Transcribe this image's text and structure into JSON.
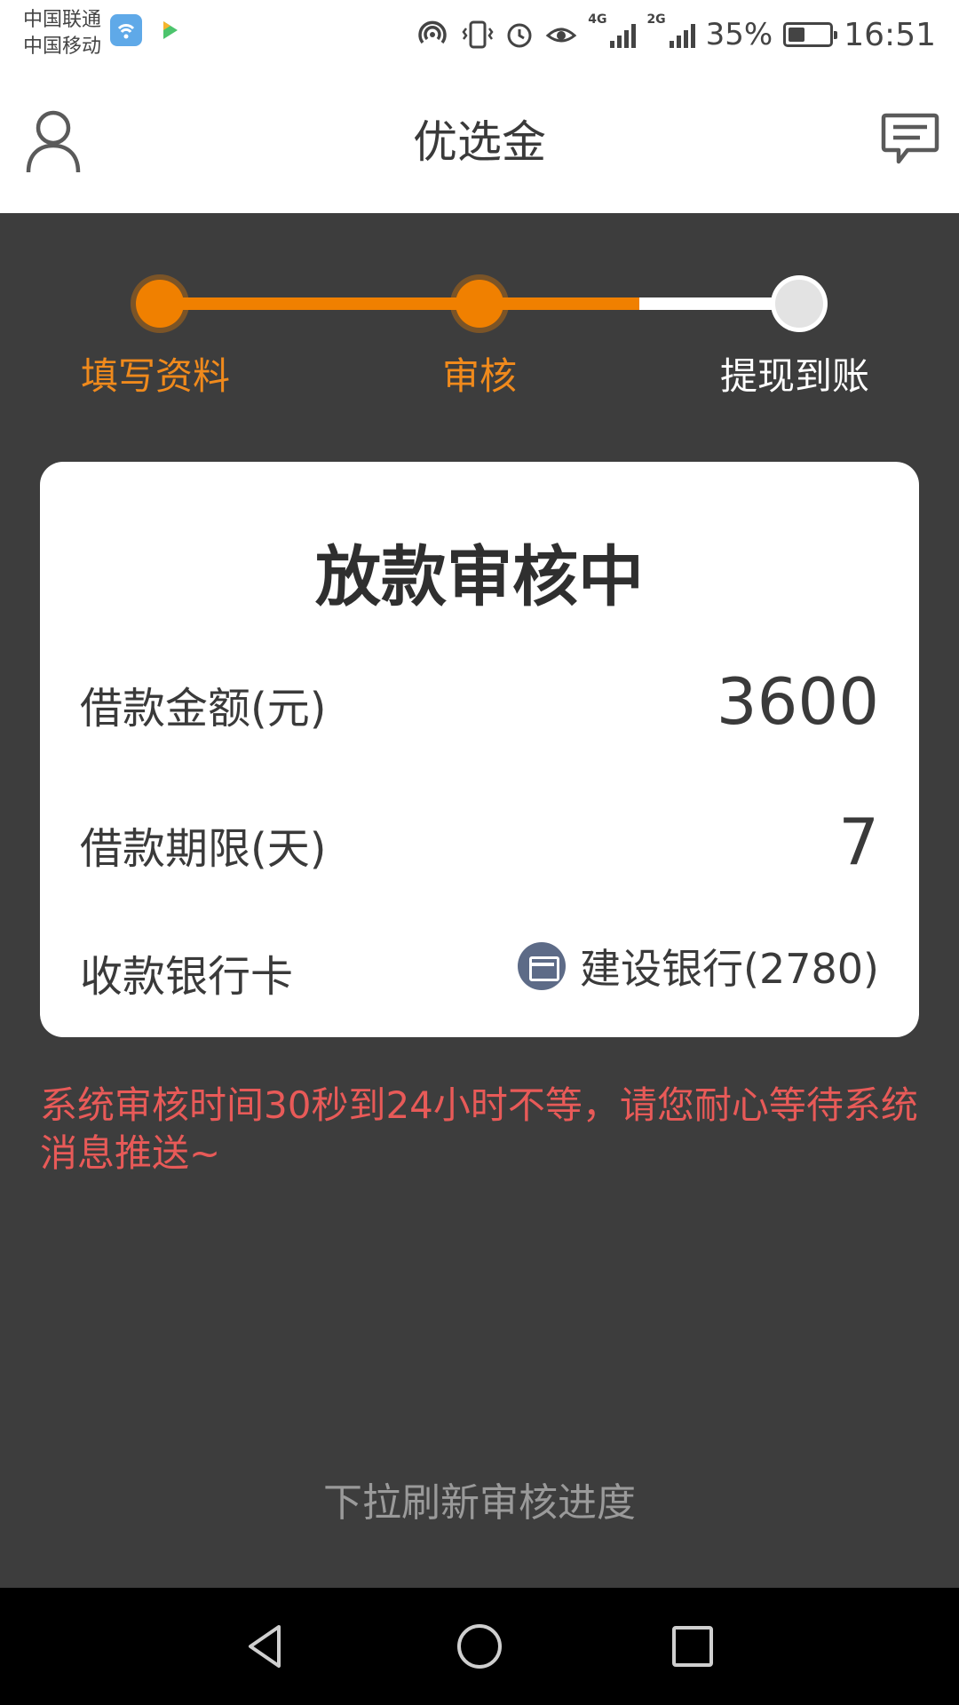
{
  "status_bar": {
    "carrier1": "中国联通",
    "carrier2": "中国移动",
    "battery_pct_text": "35%",
    "battery_level": 0.35,
    "time": "16:51",
    "net1": "4G",
    "net2": "2G",
    "icons": [
      "wifi-hotspot-icon",
      "vibrate-icon",
      "alarm-icon",
      "eye-care-icon",
      "signal-icon",
      "signal-icon",
      "battery-icon"
    ]
  },
  "header": {
    "title": "优选金",
    "left_icon": "user-icon",
    "right_icon": "message-icon"
  },
  "steps": [
    {
      "label": "填写资料",
      "state": "done"
    },
    {
      "label": "审核",
      "state": "done"
    },
    {
      "label": "提现到账",
      "state": "todo"
    }
  ],
  "card": {
    "title": "放款审核中",
    "amount_label": "借款金额(元)",
    "amount_value": "3600",
    "term_label": "借款期限(天)",
    "term_value": "7",
    "bank_label": "收款银行卡",
    "bank_value": "建设银行(2780)"
  },
  "notice": "系统审核时间30秒到24小时不等，请您耐心等待系统消息推送~",
  "pull_hint": "下拉刷新审核进度",
  "colors": {
    "accent": "#f08000",
    "notice": "#e85a58",
    "background": "#3d3d3d"
  }
}
